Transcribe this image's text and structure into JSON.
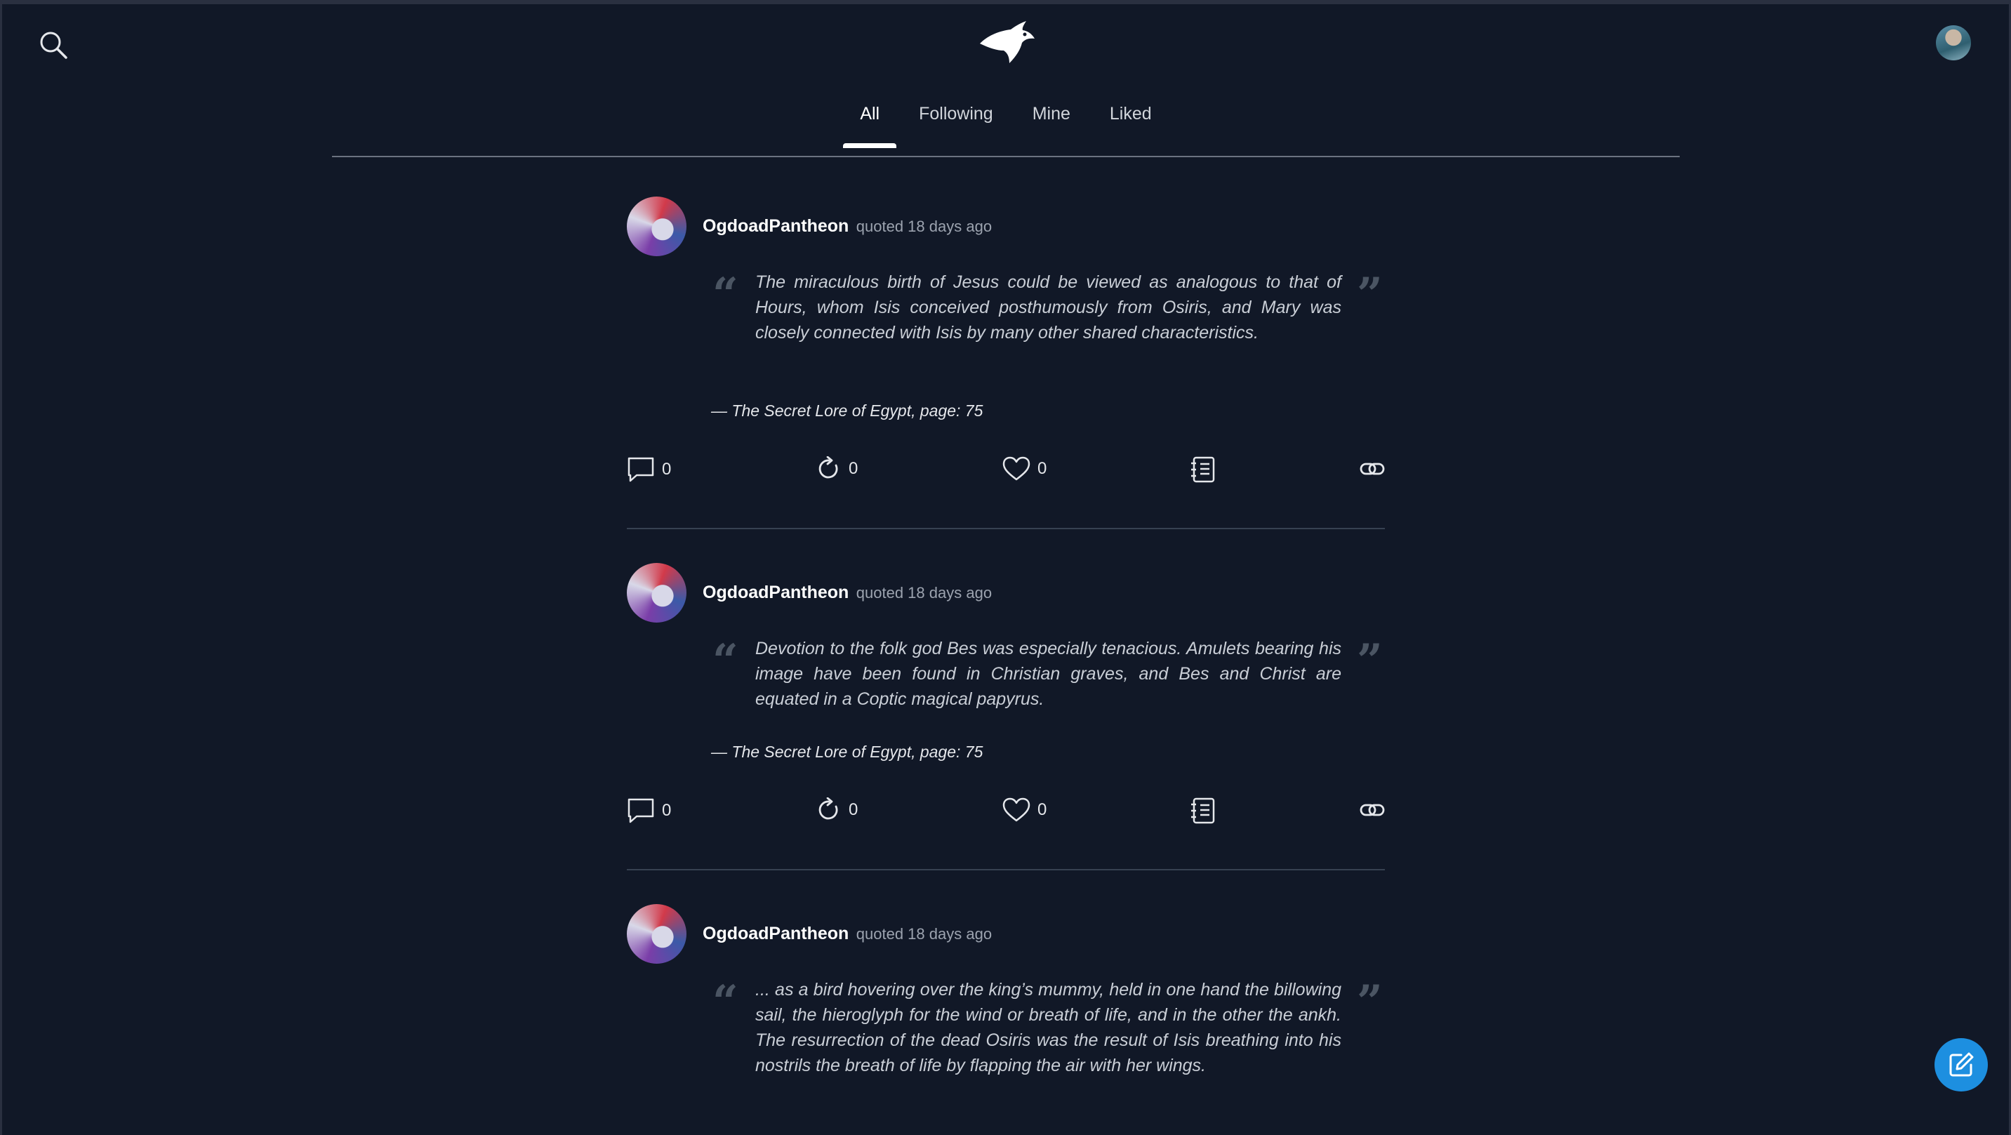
{
  "header": {
    "search_icon": "search-icon",
    "logo_icon": "eagle-head-logo",
    "avatar_icon": "user-avatar"
  },
  "tabs": [
    {
      "label": "All",
      "active": true
    },
    {
      "label": "Following",
      "active": false
    },
    {
      "label": "Mine",
      "active": false
    },
    {
      "label": "Liked",
      "active": false
    }
  ],
  "posts": [
    {
      "user": "OgdoadPantheon",
      "meta": "quoted 18 days ago",
      "quote": "The miraculous birth of Jesus could be viewed as analogous to that of Hours, whom Isis conceived posthumously from Osiris, and Mary was closely connected with Isis by many other shared characteristics.",
      "source": "— The Secret Lore of Egypt, page: 75",
      "comments": "0",
      "reposts": "0",
      "likes": "0"
    },
    {
      "user": "OgdoadPantheon",
      "meta": "quoted 18 days ago",
      "quote": "Devotion to the folk god Bes was especially tenacious. Amulets bearing his image have been found in Christian graves, and Bes and Christ are equated in a Coptic magical papyrus.",
      "source": "— The Secret Lore of Egypt, page: 75",
      "comments": "0",
      "reposts": "0",
      "likes": "0"
    },
    {
      "user": "OgdoadPantheon",
      "meta": "quoted 18 days ago",
      "quote": "... as a bird hovering over the king’s mummy, held in one hand the billowing sail, the hieroglyph for the wind or breath of life, and in the other the ankh. The resurrection of the dead Osiris was the result of Isis breathing into his nostrils the breath of life by flapping the air with her wings."
    }
  ],
  "fab": {
    "icon": "edit-icon"
  },
  "colors": {
    "background": "#111827",
    "accent": "#1d8fe0",
    "divider": "#374151"
  }
}
